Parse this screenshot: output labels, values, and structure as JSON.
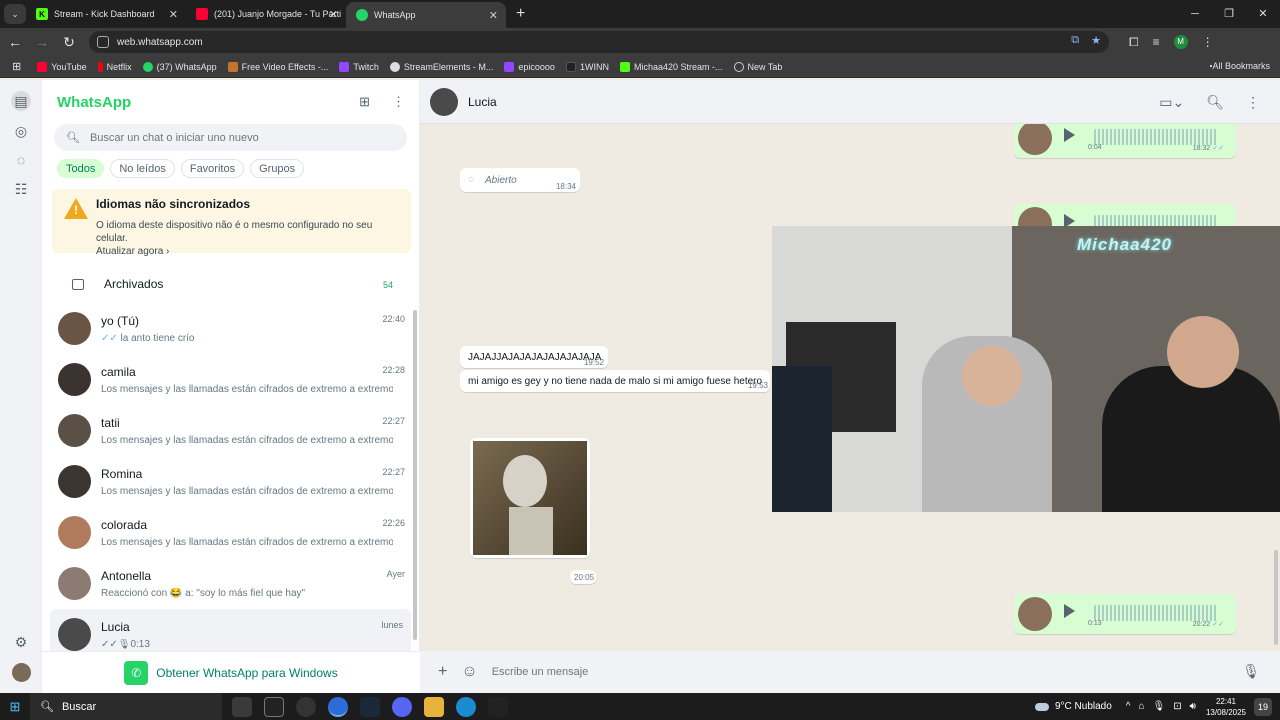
{
  "browser": {
    "tabs": [
      {
        "label": "Stream - Kick Dashboard",
        "active": false,
        "icon": "kick-icon",
        "color": "#53fc18"
      },
      {
        "label": "(201) Juanjo Morgade - Tu Parti",
        "active": false,
        "icon": "youtube-icon",
        "color": "#ff0033"
      },
      {
        "label": "WhatsApp",
        "active": true,
        "icon": "whatsapp-icon",
        "color": "#25d366"
      }
    ],
    "url": "web.whatsapp.com",
    "profile_initial": "M",
    "bookmarks": [
      "YouTube",
      "Netflix",
      "(37) WhatsApp",
      "Free Video Effects -...",
      "Twitch",
      "StreamElements - M...",
      "epicoooo",
      "1WINN",
      "Michaa420 Stream -...",
      "New Tab"
    ],
    "all_bookmarks": "All Bookmarks"
  },
  "sidebar": {
    "title": "WhatsApp",
    "search_placeholder": "Buscar un chat o iniciar uno nuevo",
    "filters": [
      "Todos",
      "No leídos",
      "Favoritos",
      "Grupos"
    ],
    "warning": {
      "title": "Idiomas não sincronizados",
      "body": "O idioma deste dispositivo não é o mesmo configurado no seu celular.",
      "link": "Atualizar agora ›"
    },
    "archived": {
      "label": "Archivados",
      "count": "54"
    },
    "chats": [
      {
        "name": "yo (Tú)",
        "time": "22:40",
        "preview": "la anto tiene crío",
        "ticks": "✓✓"
      },
      {
        "name": "camila",
        "time": "22:28",
        "preview": "Los mensajes y las llamadas están cifrados de extremo a extremo. Sol..."
      },
      {
        "name": "tatii",
        "time": "22:27",
        "preview": "Los mensajes y las llamadas están cifrados de extremo a extremo. Sol..."
      },
      {
        "name": "Romina",
        "time": "22:27",
        "preview": "Los mensajes y las llamadas están cifrados de extremo a extremo. Sol..."
      },
      {
        "name": "colorada",
        "time": "22:26",
        "preview": "Los mensajes y las llamadas están cifrados de extremo a extremo. Sol..."
      },
      {
        "name": "Antonella",
        "time": "Ayer",
        "preview": "Reaccionó con 😂 a: \"soy lo más fiel que hay\""
      },
      {
        "name": "Lucia",
        "time": "lunes",
        "preview": "✓✓🎙0:13"
      }
    ],
    "get_app": "Obtener WhatsApp para Windows"
  },
  "conversation": {
    "contact": "Lucia",
    "messages": {
      "voice1_duration": "0:04",
      "voice1_time": "18:32",
      "opened_label": "Abierto",
      "opened_time": "18:34",
      "msg1": "JAJAJJAJAJAJAJAJAJAJAJA",
      "msg1_time": "19:52",
      "msg2": "mi amigo es gey y no tiene nada de malo si mi amigo fuese hetero",
      "msg2_time": "19:53",
      "image_time": "20:05",
      "voice2_duration": "0:13",
      "voice2_time": "20:22"
    },
    "composer_placeholder": "Escribe un mensaje"
  },
  "webcam": {
    "neon_text": "Michaa420"
  },
  "taskbar": {
    "search": "Buscar",
    "weather": "9°C  Nublado",
    "time": "22:41",
    "date": "13/08/2025",
    "notifications": "19"
  }
}
